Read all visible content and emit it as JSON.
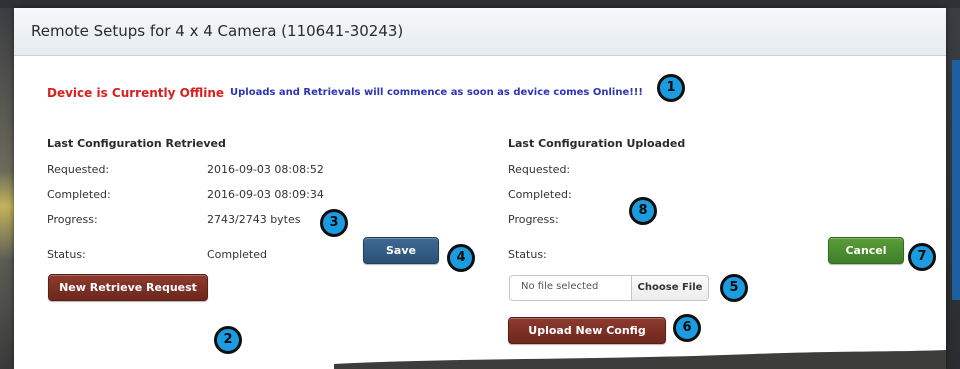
{
  "dialog": {
    "title": "Remote Setups for 4 x 4 Camera (110641-30243)"
  },
  "status_message": {
    "offline": "Device is Currently Offline",
    "notice": "Uploads and Retrievals will commence as soon as device comes Online!!!"
  },
  "retrieved": {
    "heading": "Last Configuration Retrieved",
    "requested_label": "Requested:",
    "requested_value": "2016-09-03 08:08:52",
    "completed_label": "Completed:",
    "completed_value": "2016-09-03 08:09:34",
    "progress_label": "Progress:",
    "progress_value": "2743/2743 bytes",
    "status_label": "Status:",
    "status_value": "Completed",
    "save_button": "Save",
    "new_retrieve_button": "New Retrieve Request"
  },
  "uploaded": {
    "heading": "Last Configuration Uploaded",
    "requested_label": "Requested:",
    "completed_label": "Completed:",
    "progress_label": "Progress:",
    "status_label": "Status:",
    "cancel_button": "Cancel",
    "file_placeholder": "No file selected",
    "choose_file_button": "Choose File",
    "upload_button": "Upload New Config"
  },
  "annotations": [
    "1",
    "2",
    "3",
    "4",
    "5",
    "6",
    "7",
    "8"
  ],
  "colors": {
    "offline_text": "#d81f1f",
    "notice_text": "#2b35b5",
    "retrieve_button": "#7a2e24",
    "save_button": "#345b82",
    "cancel_button": "#4b8e30",
    "badge": "#1b9be0"
  }
}
